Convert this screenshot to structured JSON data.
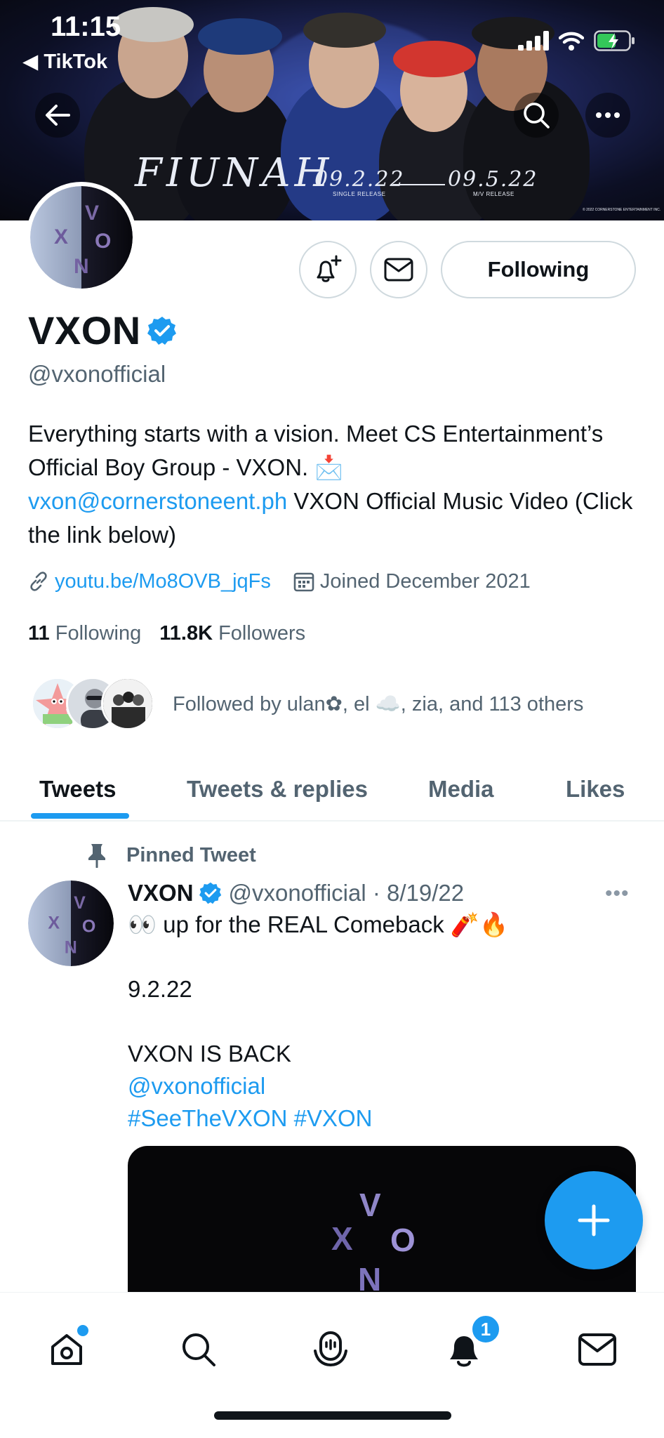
{
  "status_bar": {
    "time": "11:15",
    "back_app": "◀ TikTok"
  },
  "banner": {
    "title_art": "FIUNAH",
    "date_single": "09.2.22",
    "date_single_caption": "SINGLE RELEASE",
    "date_mv": "09.5.22",
    "date_mv_caption": "M/V RELEASE",
    "copyright": "© 2022 CORNERSTONE ENTERTAINMENT INC."
  },
  "profile": {
    "name": "VXON",
    "handle": "@vxonofficial",
    "following_button": "Following",
    "bio_text_1": "Everything starts with a vision. Meet CS Entertainment’s Official Boy Group - VXON. 📩",
    "bio_email": "vxon@cornerstoneent.ph",
    "bio_text_2": " VXON Official Music Video (Click the link below)",
    "website": "youtu.be/Mo8OVB_jqFs",
    "joined": "Joined December 2021",
    "following_count": "11",
    "following_label": "Following",
    "followers_count": "11.8K",
    "followers_label": "Followers",
    "followed_by": "Followed by ulan✿, el ☁️, zia, and 113 others"
  },
  "tabs": [
    {
      "label": "Tweets"
    },
    {
      "label": "Tweets & replies"
    },
    {
      "label": "Media"
    },
    {
      "label": "Likes"
    }
  ],
  "pinned_tweet": {
    "pinned_label": "Pinned Tweet",
    "author": "VXON",
    "handle_date": "@vxonofficial · 8/19/22",
    "more": "•••",
    "lines": [
      "👀 up for the REAL Comeback 🧨🔥",
      "",
      "9.2.22",
      "",
      "VXON IS BACK"
    ],
    "mention": "@vxonofficial",
    "hashtags": "#SeeTheVXON #VXON"
  },
  "bottom_nav": {
    "notifications_badge": "1"
  },
  "colors": {
    "accent": "#1d9bf0",
    "text": "#0f1419",
    "muted": "#536471",
    "border": "#cfd9de"
  }
}
